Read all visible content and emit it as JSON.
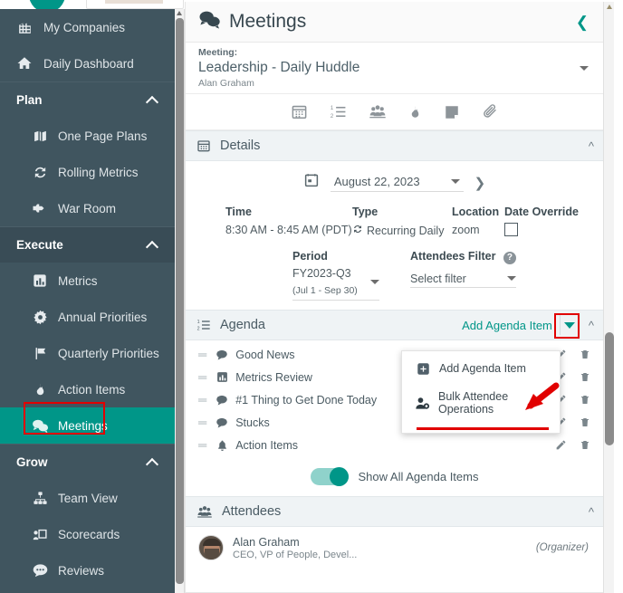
{
  "sidebar": {
    "items": [
      {
        "label": "My Companies",
        "icon": "buildings-icon",
        "type": "item"
      },
      {
        "label": "Daily Dashboard",
        "icon": "home-icon",
        "type": "item"
      },
      {
        "label": "Plan",
        "icon": "chevron-up-icon",
        "type": "group"
      },
      {
        "label": "One Page Plans",
        "icon": "map-icon",
        "type": "sub"
      },
      {
        "label": "Rolling Metrics",
        "icon": "refresh-icon",
        "type": "sub"
      },
      {
        "label": "War Room",
        "icon": "plane-icon",
        "type": "sub"
      },
      {
        "label": "Execute",
        "icon": "chevron-up-icon",
        "type": "group"
      },
      {
        "label": "Metrics",
        "icon": "bar-chart-icon",
        "type": "sub"
      },
      {
        "label": "Annual Priorities",
        "icon": "gear-star-icon",
        "type": "sub"
      },
      {
        "label": "Quarterly Priorities",
        "icon": "flag-icon",
        "type": "sub"
      },
      {
        "label": "Action Items",
        "icon": "flame-icon",
        "type": "sub"
      },
      {
        "label": "Meetings",
        "icon": "chat-bubbles-icon",
        "type": "sub",
        "active": true
      },
      {
        "label": "Grow",
        "icon": "chevron-up-icon",
        "type": "group"
      },
      {
        "label": "Team View",
        "icon": "org-chart-icon",
        "type": "sub"
      },
      {
        "label": "Scorecards",
        "icon": "presentation-icon",
        "type": "sub"
      },
      {
        "label": "Reviews",
        "icon": "comment-dots-icon",
        "type": "sub"
      }
    ]
  },
  "panel": {
    "title": "Meetings",
    "title_icon": "chat-bubbles-icon",
    "collapse_icon": "chevron-left-icon",
    "meeting": {
      "label": "Meeting:",
      "name": "Leadership - Daily Huddle",
      "owner": "Alan Graham",
      "dropdown_icon": "caret-down-icon"
    },
    "toolbar": [
      {
        "icon": "calendar-icon",
        "name": "details"
      },
      {
        "icon": "numbered-list-icon",
        "name": "agenda"
      },
      {
        "icon": "attendees-icon",
        "name": "attendees"
      },
      {
        "icon": "flame-icon",
        "name": "action-items"
      },
      {
        "icon": "note-icon",
        "name": "notes"
      },
      {
        "icon": "paperclip-icon",
        "name": "attachments"
      }
    ],
    "details": {
      "title": "Details",
      "icon": "calendar-icon",
      "collapse_icon": "chevron-up-icon",
      "date": "August 22, 2023",
      "date_icon": "calendar-day-icon",
      "next_icon": "chevron-right-icon",
      "fields": [
        {
          "header": "Time",
          "value": "8:30 AM - 8:45 AM (PDT)"
        },
        {
          "header": "Type",
          "value": "Recurring Daily",
          "icon": "recurring-icon"
        },
        {
          "header": "Location",
          "value": "zoom"
        },
        {
          "header": "Date Override",
          "value": "",
          "control": "checkbox"
        }
      ],
      "period": {
        "header": "Period",
        "value": "FY2023-Q3",
        "sub": "(Jul 1 - Sep 30)"
      },
      "attendees_filter": {
        "header": "Attendees Filter",
        "help_icon": "question-mark-icon",
        "placeholder": "Select filter"
      }
    },
    "agenda": {
      "title": "Agenda",
      "icon": "numbered-list-icon",
      "add_link": "Add Agenda Item",
      "caret_icon": "caret-down-icon",
      "collapse_icon": "chevron-up-icon",
      "items": [
        {
          "label": "Good News",
          "icon": "chat-bubble-icon"
        },
        {
          "label": "Metrics Review",
          "icon": "bar-chart-icon"
        },
        {
          "label": "#1 Thing to Get Done Today",
          "icon": "chat-bubble-icon"
        },
        {
          "label": "Stucks",
          "icon": "chat-bubble-icon"
        },
        {
          "label": "Action Items",
          "icon": "bell-icon"
        }
      ],
      "row_actions": {
        "edit": "pencil-icon",
        "delete": "trash-icon",
        "drag": "drag-handle-icon"
      },
      "toggle_label": "Show All Agenda Items",
      "toggle_on": true
    },
    "dropdown_menu": {
      "items": [
        {
          "label": "Add Agenda Item",
          "icon": "plus-square-icon"
        },
        {
          "label": "Bulk Attendee Operations",
          "icon": "user-gear-icon"
        }
      ]
    },
    "attendees": {
      "title": "Attendees",
      "icon": "attendees-icon",
      "collapse_icon": "chevron-up-icon",
      "list": [
        {
          "name": "Alan Graham",
          "role": "CEO, VP of People, Devel...",
          "tag": "(Organizer)"
        }
      ]
    }
  },
  "colors": {
    "sidebar_bg": "#40555f",
    "sidebar_group_bg": "#394c56",
    "accent_teal": "#009688",
    "annotation_red": "#e10000",
    "section_bg": "#eff3f5"
  }
}
